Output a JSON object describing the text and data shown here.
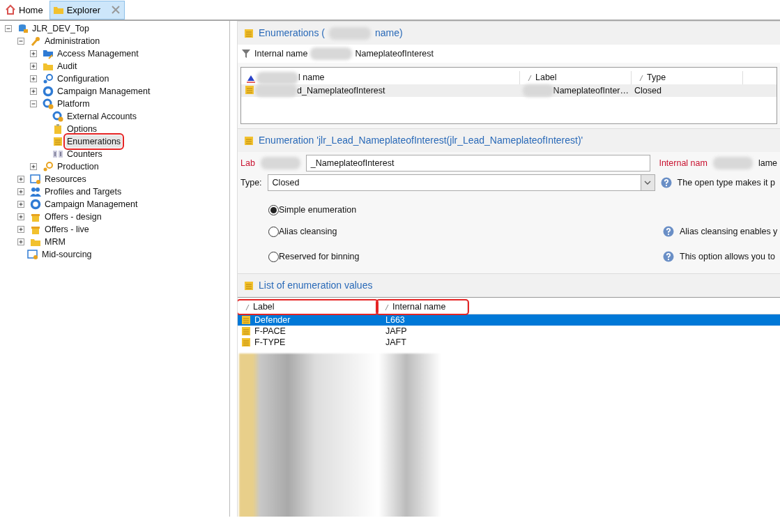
{
  "tabs": [
    {
      "label": "Home",
      "kind": "home",
      "selected": false,
      "closable": false
    },
    {
      "label": "Explorer",
      "kind": "folder",
      "selected": true,
      "closable": true
    }
  ],
  "tree": [
    {
      "label": "JLR_DEV_Top",
      "kind": "database",
      "expanded": true,
      "highlighted": false,
      "children": [
        {
          "label": "Administration",
          "kind": "wrench",
          "expanded": true,
          "highlighted": false,
          "children": [
            {
              "label": "Access Management",
              "kind": "folder-blue",
              "expanded": false,
              "highlighted": false
            },
            {
              "label": "Audit",
              "kind": "folder",
              "expanded": false,
              "highlighted": false
            },
            {
              "label": "Configuration",
              "kind": "gears-blue",
              "expanded": false,
              "highlighted": false
            },
            {
              "label": "Campaign Management",
              "kind": "ring",
              "expanded": false,
              "highlighted": false
            },
            {
              "label": "Platform",
              "kind": "gear-globe",
              "expanded": true,
              "highlighted": false,
              "children": [
                {
                  "label": "External Accounts",
                  "kind": "gear-globe",
                  "highlighted": false
                },
                {
                  "label": "Options",
                  "kind": "clipboard",
                  "highlighted": false
                },
                {
                  "label": "Enumerations",
                  "kind": "list",
                  "highlighted": true
                },
                {
                  "label": "Counters",
                  "kind": "counter",
                  "highlighted": false
                }
              ]
            },
            {
              "label": "Production",
              "kind": "gears-orange",
              "expanded": false,
              "highlighted": false
            }
          ]
        },
        {
          "label": "Resources",
          "kind": "resources",
          "expanded": false,
          "highlighted": false
        },
        {
          "label": "Profiles and Targets",
          "kind": "people",
          "expanded": false,
          "highlighted": false
        },
        {
          "label": "Campaign Management",
          "kind": "ring",
          "expanded": false,
          "highlighted": false
        },
        {
          "label": "Offers - design",
          "kind": "gift",
          "expanded": false,
          "highlighted": false
        },
        {
          "label": "Offers - live",
          "kind": "gift",
          "expanded": false,
          "highlighted": false
        },
        {
          "label": "MRM",
          "kind": "folder",
          "expanded": false,
          "highlighted": false
        },
        {
          "label": "Mid-sourcing",
          "kind": "resources",
          "highlighted": false
        }
      ]
    }
  ],
  "list_panel": {
    "title_parts": [
      "Enumerations (",
      "name)"
    ],
    "filter_parts": [
      "Internal name",
      "NameplateofInterest"
    ],
    "columns": [
      {
        "label": "l name"
      },
      {
        "label": "Label"
      },
      {
        "label": "Type"
      }
    ],
    "rows": [
      {
        "cells": [
          "d_NameplateofInterest",
          "NameplateofInter…",
          "Closed"
        ],
        "selected": false
      }
    ]
  },
  "detail_panel": {
    "title": "Enumeration 'jlr_Lead_NameplateofInterest(jlr_Lead_NameplateofInterest)'",
    "label_field": {
      "label": "Lab",
      "value": "_NameplateofInterest"
    },
    "internal_name_field": {
      "label": "Internal nam",
      "value": "lame"
    },
    "type_field": {
      "label": "Type:",
      "value": "Closed",
      "help": "The open type makes it p"
    },
    "options": [
      {
        "label": "Simple enumeration",
        "selected": true
      },
      {
        "label": "Alias cleansing",
        "selected": false,
        "help": "Alias cleansing enables y"
      },
      {
        "label": "Reserved for binning",
        "selected": false,
        "help": "This option allows you to"
      }
    ]
  },
  "values_panel": {
    "title": "List of enumeration values",
    "columns": [
      {
        "label": "Label",
        "highlighted": true
      },
      {
        "label": "Internal name",
        "highlighted": true
      }
    ],
    "rows": [
      {
        "label": "Defender",
        "internal_name": "L663",
        "selected": true
      },
      {
        "label": "F-PACE",
        "internal_name": "JAFP",
        "selected": false
      },
      {
        "label": "F-TYPE",
        "internal_name": "JAFT",
        "selected": false
      }
    ]
  }
}
